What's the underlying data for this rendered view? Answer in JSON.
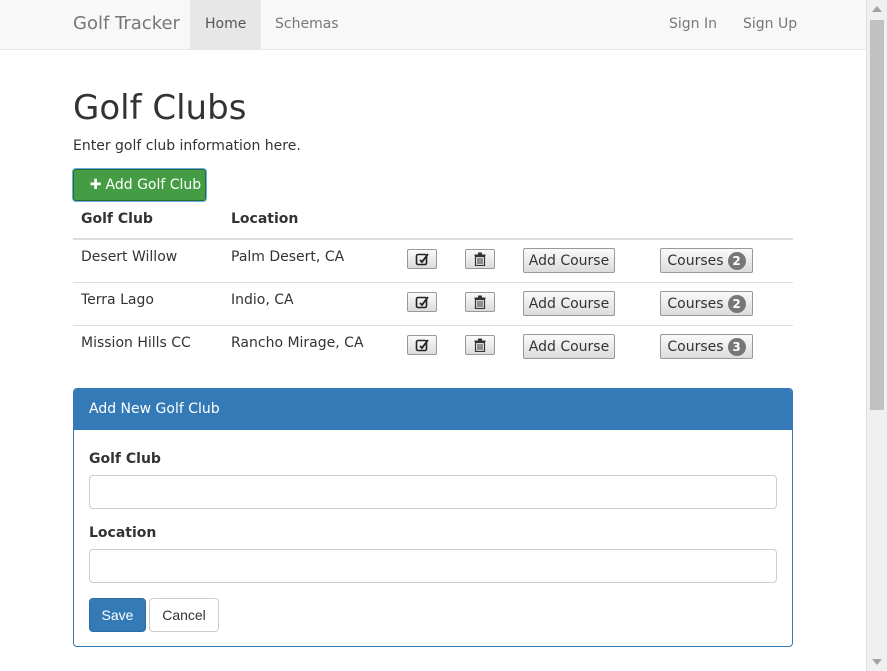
{
  "navbar": {
    "brand": "Golf Tracker",
    "links": [
      {
        "label": "Home",
        "active": true
      },
      {
        "label": "Schemas",
        "active": false
      }
    ],
    "right_links": [
      {
        "label": "Sign In"
      },
      {
        "label": "Sign Up"
      }
    ]
  },
  "page": {
    "title": "Golf Clubs",
    "lead": "Enter golf club information here.",
    "add_button_label": "Add Golf Club"
  },
  "table": {
    "headers": [
      "Golf Club",
      "Location"
    ],
    "add_course_label": "Add Course",
    "courses_label": "Courses",
    "rows": [
      {
        "club": "Desert Willow",
        "location": "Palm Desert, CA",
        "courses": "2"
      },
      {
        "club": "Terra Lago",
        "location": "Indio, CA",
        "courses": "2"
      },
      {
        "club": "Mission Hills CC",
        "location": "Rancho Mirage, CA",
        "courses": "3"
      }
    ]
  },
  "panel": {
    "heading": "Add New Golf Club",
    "fields": [
      {
        "label": "Golf Club",
        "value": ""
      },
      {
        "label": "Location",
        "value": ""
      }
    ],
    "save_label": "Save",
    "cancel_label": "Cancel"
  },
  "colors": {
    "primary": "#337ab7",
    "success": "#449d44",
    "badge": "#777777"
  }
}
